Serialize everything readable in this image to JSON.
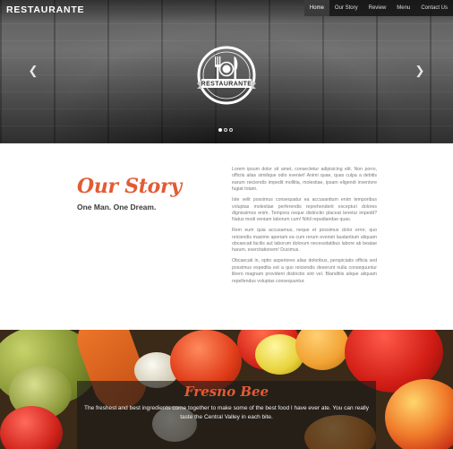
{
  "header": {
    "brand": "RESTAURANTE",
    "nav": [
      {
        "label": "Home",
        "active": true
      },
      {
        "label": "Our Story",
        "active": false
      },
      {
        "label": "Review",
        "active": false
      },
      {
        "label": "Menu",
        "active": false
      },
      {
        "label": "Contact Us",
        "active": false
      }
    ]
  },
  "hero": {
    "logo_text": "RESTAURANTE",
    "prev_icon": "chevron-left-icon",
    "next_icon": "chevron-right-icon",
    "slides": 3,
    "active_slide": 1
  },
  "story": {
    "title": "Our Story",
    "subtitle": "One Man. One Dream.",
    "paragraphs": [
      "Lorem ipsum dolor sit amet, consectetur adipisicing elit. Non porro, officiis alias similique odio eveniet! Animi quae, quas culpa a debitis earum reiciendis impedit mollitia, molestiae, ipsam eligendi inventore fugiat totam.",
      "Iste velit possimus consequatur ea accusantium enim temporibus voluptas molestiae perferendis reprehenderit excepturi dolores dignissimos enim. Tempora neque distinctio placeat tenetur impedit? Natus modi veniam laborum cum! Nihil repudiandae quas.",
      "Rem eum quia accusamus, neque et possimus dolor error, quo reiciendis maxime aperiam ea cum rerum eveniet laudantium aliquam obcaecati facilis aut laborum dolorum necessitatibus labore ab beatae harum, exercitationem! Ducimus.",
      "Obcaecati in, optio asperiores alias doloribus, perspiciatis officia sed possimus expedita est a quo reiciendis deserunt nulla consequuntur libero magnam provident distinctio sint vel. Blanditiis alique aliquam repellendus voluptas consequuntur."
    ]
  },
  "banner": {
    "title": "Fresno Bee",
    "quote": "The freshest and best ingredients come together to make some of the best food I have ever ate. You can really taste the Central Valley in each bite."
  },
  "colors": {
    "accent": "#e35b34",
    "nav_bg": "#141414",
    "text_muted": "#7a7a7a"
  }
}
